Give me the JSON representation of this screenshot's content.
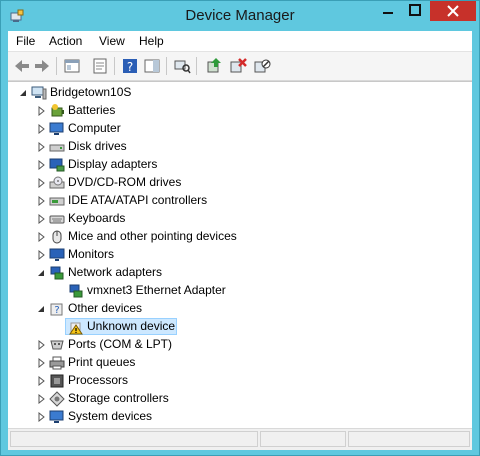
{
  "window": {
    "title": "Device Manager"
  },
  "menubar": {
    "items": [
      "File",
      "Action",
      "View",
      "Help"
    ]
  },
  "toolbar": {
    "buttons": [
      "back-arrow-icon",
      "forward-arrow-icon",
      "show-hide-tree-icon",
      "properties-icon",
      "help-icon",
      "action-pane-icon",
      "scan-hardware-icon",
      "update-driver-icon",
      "uninstall-icon",
      "disable-icon"
    ]
  },
  "tree": {
    "root": "Bridgetown10S",
    "nodes": [
      {
        "label": "Batteries",
        "icon": "battery-icon",
        "expanded": false
      },
      {
        "label": "Computer",
        "icon": "computer-icon",
        "expanded": false
      },
      {
        "label": "Disk drives",
        "icon": "disk-drive-icon",
        "expanded": false
      },
      {
        "label": "Display adapters",
        "icon": "display-adapter-icon",
        "expanded": false
      },
      {
        "label": "DVD/CD-ROM drives",
        "icon": "dvd-drive-icon",
        "expanded": false
      },
      {
        "label": "IDE ATA/ATAPI controllers",
        "icon": "ide-controller-icon",
        "expanded": false
      },
      {
        "label": "Keyboards",
        "icon": "keyboard-icon",
        "expanded": false
      },
      {
        "label": "Mice and other pointing devices",
        "icon": "mouse-icon",
        "expanded": false
      },
      {
        "label": "Monitors",
        "icon": "monitor-icon",
        "expanded": false
      },
      {
        "label": "Network adapters",
        "icon": "network-adapter-icon",
        "expanded": true,
        "children": [
          {
            "label": "vmxnet3 Ethernet Adapter",
            "icon": "network-adapter-icon"
          }
        ]
      },
      {
        "label": "Other devices",
        "icon": "other-devices-icon",
        "expanded": true,
        "children": [
          {
            "label": "Unknown device",
            "icon": "warning-icon",
            "selected": true
          }
        ]
      },
      {
        "label": "Ports (COM & LPT)",
        "icon": "port-icon",
        "expanded": false
      },
      {
        "label": "Print queues",
        "icon": "printer-icon",
        "expanded": false
      },
      {
        "label": "Processors",
        "icon": "processor-icon",
        "expanded": false
      },
      {
        "label": "Storage controllers",
        "icon": "storage-controller-icon",
        "expanded": false
      },
      {
        "label": "System devices",
        "icon": "system-devices-icon",
        "expanded": false
      }
    ]
  },
  "colors": {
    "chrome": "#5fc8df",
    "close": "#c7312a",
    "selection": "#cde8ff",
    "selection_border": "#99d1ff"
  }
}
